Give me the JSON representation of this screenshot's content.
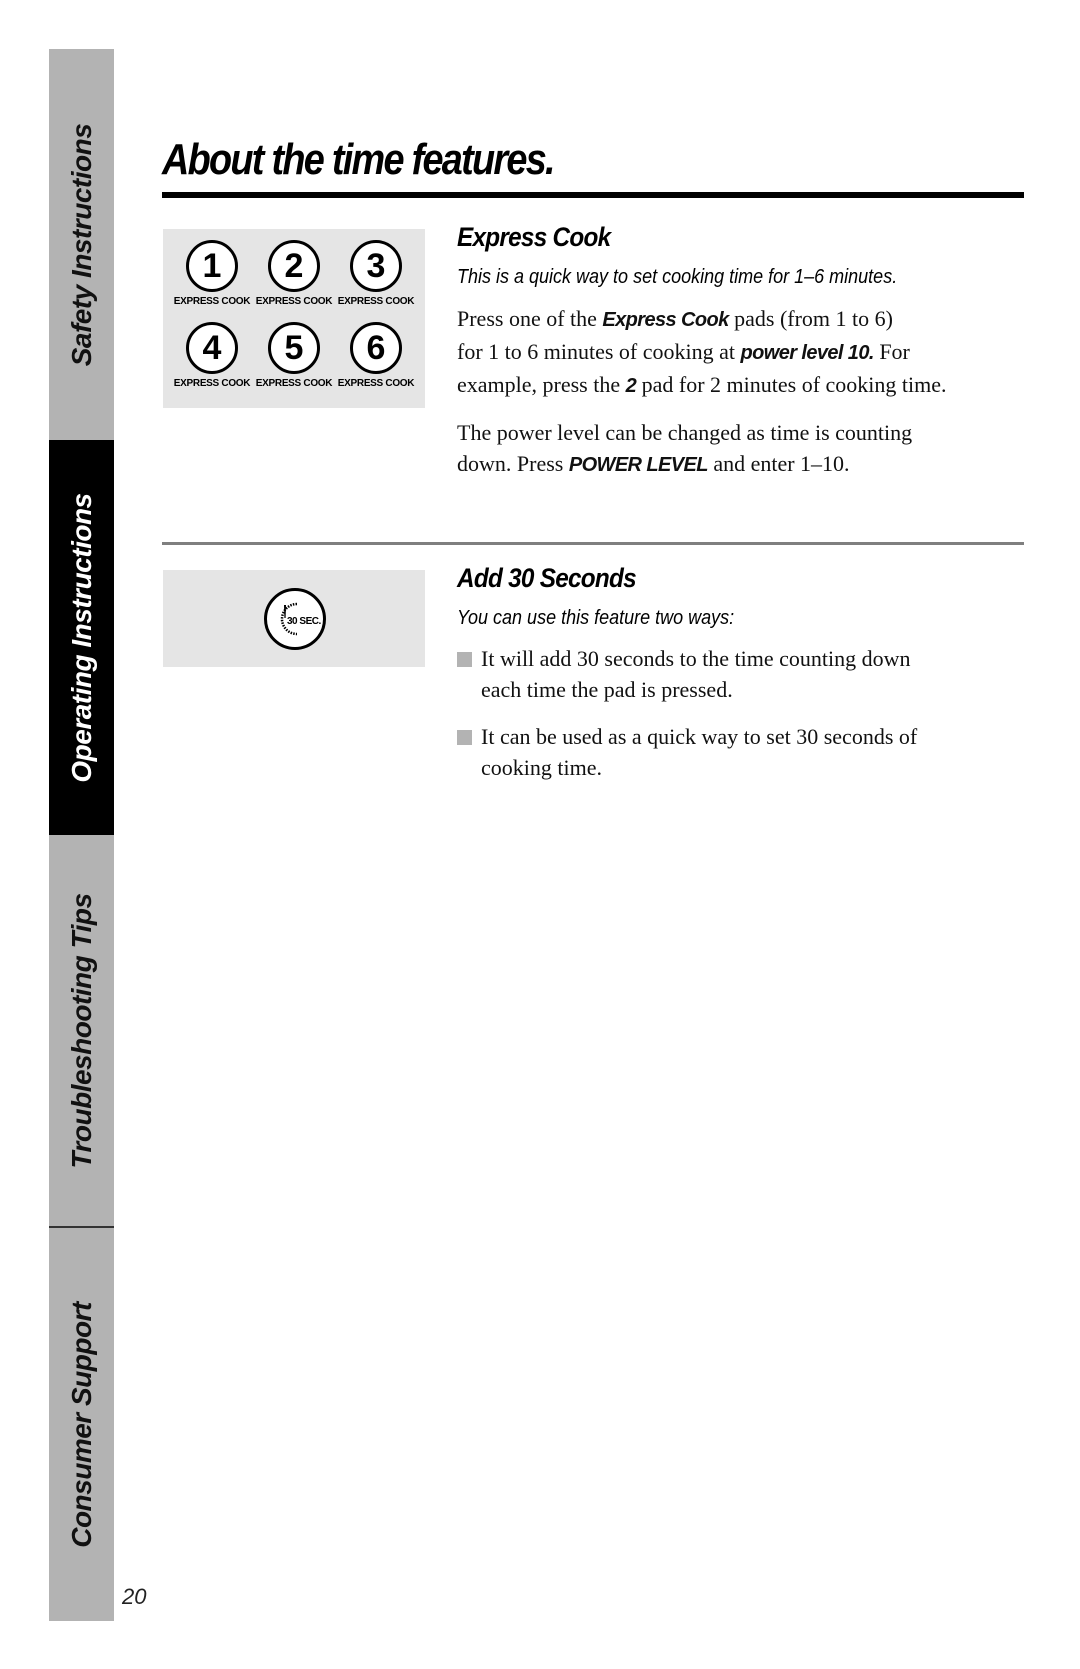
{
  "sidebar": {
    "tabs": [
      {
        "label": "Safety Instructions",
        "active": false
      },
      {
        "label": "Operating Instructions",
        "active": true
      },
      {
        "label": "Troubleshooting Tips",
        "active": false
      },
      {
        "label": "Consumer Support",
        "active": false
      }
    ]
  },
  "page": {
    "title": "About the time features.",
    "number": "20"
  },
  "express_cook": {
    "heading": "Express Cook",
    "lead": "This is a quick way to set cooking time for 1–6 minutes.",
    "pads": [
      {
        "number": "1",
        "label": "EXPRESS COOK"
      },
      {
        "number": "2",
        "label": "EXPRESS COOK"
      },
      {
        "number": "3",
        "label": "EXPRESS COOK"
      },
      {
        "number": "4",
        "label": "EXPRESS COOK"
      },
      {
        "number": "5",
        "label": "EXPRESS COOK"
      },
      {
        "number": "6",
        "label": "EXPRESS COOK"
      }
    ],
    "p1": {
      "t1": "Press one of the ",
      "b1": "Express Cook",
      "t2": "  pads (from 1 to 6)",
      "t3": "for 1 to 6 minutes of cooking at ",
      "b2": "power level 10.",
      "t4": "  For",
      "t5": "example, press the ",
      "b3": "2",
      "t6": "  pad for 2 minutes of cooking time."
    },
    "p2": {
      "t1": "The power level can be changed as time is counting",
      "t2": "down. Press ",
      "b1": "POWER LEVEL",
      "t3": " and enter 1–10."
    }
  },
  "add_30": {
    "heading": "Add 30 Seconds",
    "lead": "You can use this feature two ways:",
    "pad_label": "30 SEC.",
    "bullets": [
      {
        "line1": "It will add 30 seconds to the time counting down",
        "line2": "each time the pad is pressed."
      },
      {
        "line1": "It can be used as a quick way to set 30 seconds of",
        "line2": "cooking time."
      }
    ]
  }
}
